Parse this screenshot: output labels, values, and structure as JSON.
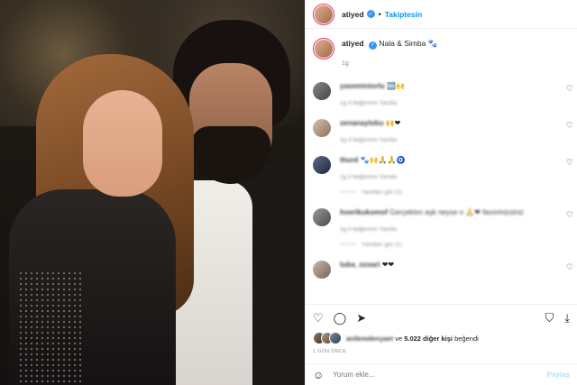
{
  "header": {
    "username": "atiyed",
    "separator": "•",
    "follow_label": "Takiptesin"
  },
  "caption": {
    "username": "atiyed",
    "text": "Nala & Simba 🐾",
    "time": "1g"
  },
  "comments": [
    {
      "username": "yasemintorlu",
      "text": "🔤🙌",
      "meta": "1g   4 beğenme   Yanıtla",
      "replies": ""
    },
    {
      "username": "zenanaylobu",
      "text": "🙌❤",
      "meta": "1g   4 beğenme   Yanıtla",
      "replies": ""
    },
    {
      "username": "thurd",
      "text": "🐾🙌🙏🙏🧿",
      "meta": "1g   4 beğenme   Yanıtla",
      "replies": "Yanıtları gör (1)"
    },
    {
      "username": "hoerikukomof",
      "text": "Gerçekten aşk neyse o 🙏❤ favorinizsiniz",
      "meta": "1g   4 beğenme   Yanıtla",
      "replies": "Yanıtları gör (1)"
    },
    {
      "username": "tuba_ozsari",
      "text": "❤❤",
      "meta": "",
      "replies": ""
    }
  ],
  "likes": {
    "liker": "anilemdenyaet",
    "rest_prefix": " ve ",
    "count_label": "5.022 diğer kişi",
    "suffix": " beğendi"
  },
  "time_ago": "1 GÜN ÖNCE",
  "comment_box": {
    "placeholder": "Yorum ekle...",
    "post_label": "Paylaş"
  },
  "colors": {
    "accent": "#0095f6",
    "verified": "#3897f0"
  }
}
